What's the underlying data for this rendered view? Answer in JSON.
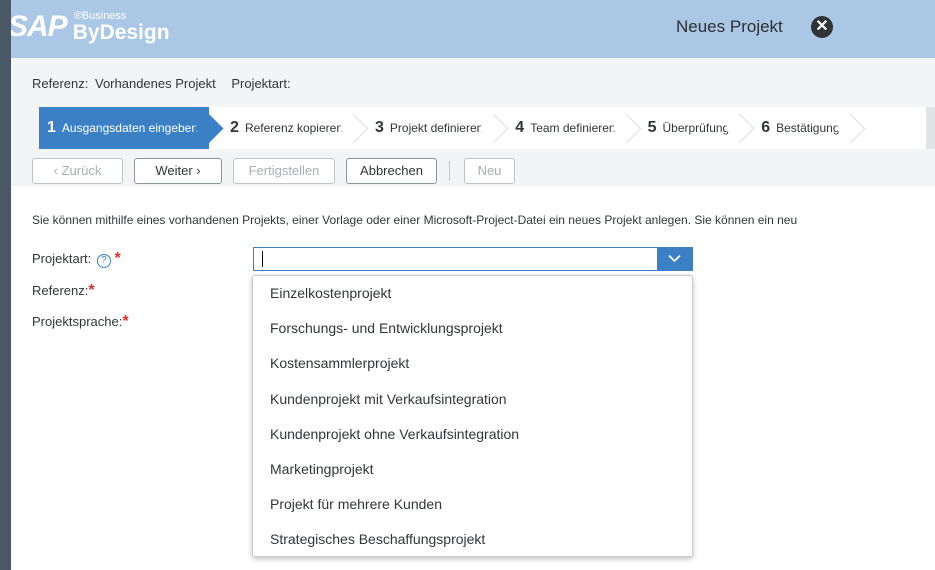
{
  "header": {
    "logo_sap": "SAP",
    "logo_business": "®Business",
    "logo_bydesign": "ByDesign",
    "window_title": "Neues Projekt",
    "close_glyph": "✕"
  },
  "reference_line": {
    "ref_label": "Referenz:",
    "ref_value": "Vorhandenes Projekt",
    "project_type_label": "Projektart:"
  },
  "steps": [
    {
      "num": "1",
      "label": "Ausgangsdaten eingeben",
      "active": true
    },
    {
      "num": "2",
      "label": "Referenz kopieren",
      "active": false
    },
    {
      "num": "3",
      "label": "Projekt definieren",
      "active": false
    },
    {
      "num": "4",
      "label": "Team definieren",
      "active": false
    },
    {
      "num": "5",
      "label": "Überprüfung",
      "active": false
    },
    {
      "num": "6",
      "label": "Bestätigung",
      "active": false
    }
  ],
  "toolbar": {
    "back": "‹  Zurück",
    "next": "Weiter  ›",
    "finish": "Fertigstellen",
    "cancel": "Abbrechen",
    "new": "Neu"
  },
  "info_text": "Sie können mithilfe eines vorhandenen Projekts, einer Vorlage oder einer Microsoft-Project-Datei ein neues Projekt anlegen. Sie können ein neu",
  "form": {
    "project_type_label": "Projektart:",
    "help_glyph": "?",
    "reference_label": "Referenz:",
    "language_label": "Projektsprache:",
    "required_marker": "*",
    "project_type_value": ""
  },
  "dropdown_options": [
    "Einzelkostenprojekt",
    "Forschungs- und Entwicklungsprojekt",
    "Kostensammlerprojekt",
    "Kundenprojekt mit Verkaufsintegration",
    "Kundenprojekt ohne Verkaufsintegration",
    "Marketingprojekt",
    "Projekt für mehrere Kunden",
    "Strategisches Beschaffungsprojekt"
  ],
  "colors": {
    "header_bg": "#aac8e6",
    "accent": "#3b80c4",
    "required": "#e0322c"
  },
  "icons": {
    "close": "close-circle-icon",
    "help": "help-icon",
    "dropdown": "chevron-down-icon"
  }
}
